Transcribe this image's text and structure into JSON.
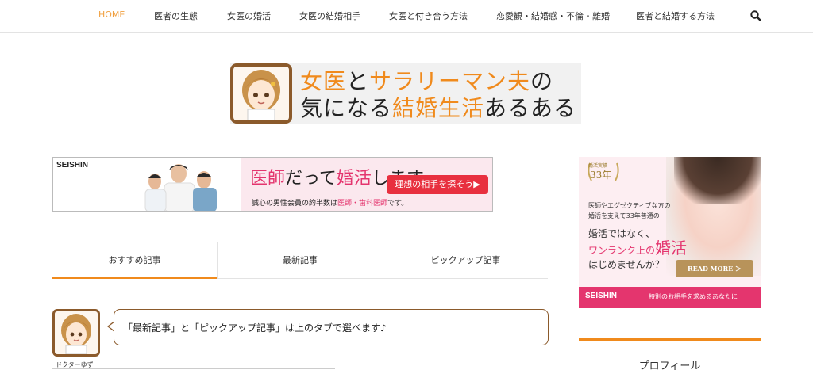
{
  "nav": {
    "items": [
      {
        "label": "HOME"
      },
      {
        "label": "医者の生態"
      },
      {
        "label": "女医の婚活"
      },
      {
        "label": "女医の結婚相手"
      },
      {
        "label": "女医と付き合う方法"
      },
      {
        "label": "恋愛観・結婚感・不倫・離婚"
      },
      {
        "label": "医者と結婚する方法"
      }
    ],
    "search_icon": "search-icon",
    "active_color": "#f0a040"
  },
  "site_banner": {
    "line1_a": "女医",
    "line1_b": "と",
    "line1_c": "サラリーマン夫",
    "line1_d": "の",
    "line2_a": "気になる",
    "line2_b": "結婚生活",
    "line2_c": "あるある",
    "accent": "#f08a1c"
  },
  "ad_banner": {
    "brand": "SEISHIN",
    "headline_a": "医師",
    "headline_b": "だって",
    "headline_c": "婚活",
    "headline_d": "します。",
    "sub_a": "誠心の男性会員の約半数は",
    "sub_b": "医師・歯科医師",
    "sub_c": "です。",
    "cta": "理想の相手を探そう▶"
  },
  "tabs": [
    {
      "label": "おすすめ記事"
    },
    {
      "label": "最新記事"
    },
    {
      "label": "ピックアップ記事"
    }
  ],
  "speech": {
    "name": "ドクターゆず",
    "text": "「最新記事」と「ピックアップ記事」は上のタブで選べます♪"
  },
  "side_ad": {
    "badge_top": "婚活実績",
    "badge_years": "33年",
    "intro_1": "医師やエグゼクティブな方の",
    "intro_2": "婚活を支えて33年普通の",
    "copy_1": "婚活ではなく、",
    "copy_2a": "ワンランク上の",
    "copy_2b": "婚活",
    "copy_3": "はじめませんか？",
    "more": "READ MORE ＞",
    "foot_brand": "SEISHIN",
    "foot_text": "特別のお相手を求めるあなたに"
  },
  "sidebar": {
    "profile_title": "プロフィール"
  }
}
